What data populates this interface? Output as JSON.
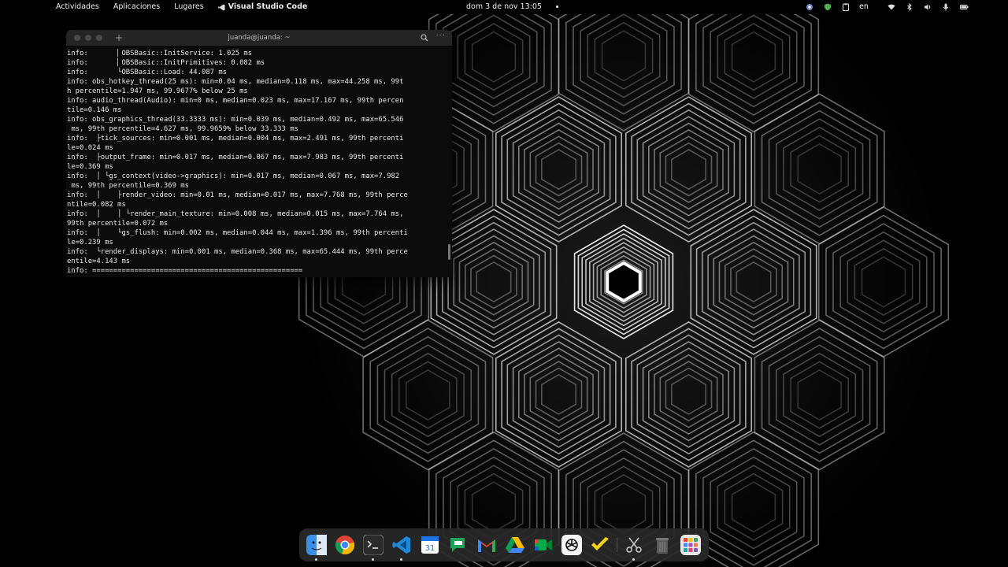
{
  "topbar": {
    "activities": "Actividades",
    "applications": "Aplicaciones",
    "places": "Lugares",
    "active_app": "Visual Studio Code",
    "datetime": "dom 3 de nov  13:05",
    "language": "en",
    "tray_icons": [
      "screenshot-icon",
      "shield-icon",
      "clipboard-icon",
      "wifi-icon",
      "bluetooth-icon",
      "volume-icon",
      "microphone-icon",
      "battery-icon"
    ]
  },
  "terminal": {
    "title": "juanda@juanda: ~",
    "lines": [
      "info:       ▏OBSBasic::InitService: 1.025 ms",
      "info:       ▏OBSBasic::InitPrimitives: 0.082 ms",
      "info:       └OBSBasic::Load: 44.087 ms",
      "info: obs_hotkey_thread(25 ms): min=0.04 ms, median=0.118 ms, max=44.258 ms, 99t",
      "h percentile=1.947 ms, 99.9677% below 25 ms",
      "info: audio_thread(Audio): min=0 ms, median=0.023 ms, max=17.167 ms, 99th percen",
      "tile=0.146 ms",
      "info: obs_graphics_thread(33.3333 ms): min=0.039 ms, median=0.492 ms, max=65.546",
      " ms, 99th percentile=4.627 ms, 99.9659% below 33.333 ms",
      "info:  ├tick_sources: min=0.001 ms, median=0.004 ms, max=2.491 ms, 99th percenti",
      "le=0.024 ms",
      "info:  ├output_frame: min=0.017 ms, median=0.067 ms, max=7.983 ms, 99th percenti",
      "le=0.369 ms",
      "info:  │ └gs_context(video->graphics): min=0.017 ms, median=0.067 ms, max=7.982",
      " ms, 99th percentile=0.369 ms",
      "info:  │    ├render_video: min=0.01 ms, median=0.017 ms, max=7.768 ms, 99th perce",
      "ntile=0.082 ms",
      "info:  │    │ └render_main_texture: min=0.008 ms, median=0.015 ms, max=7.764 ms,",
      "99th percentile=0.072 ms",
      "info:  │    └gs_flush: min=0.002 ms, median=0.044 ms, max=1.396 ms, 99th percenti",
      "le=0.239 ms",
      "info:  └render_displays: min=0.001 ms, median=0.368 ms, max=65.444 ms, 99th perce",
      "entile=4.143 ms",
      "info: =================================================="
    ]
  },
  "dock": {
    "apps": [
      {
        "name": "finder",
        "color": "#3a8fe8"
      },
      {
        "name": "chrome",
        "color": "#e8e8e8"
      },
      {
        "name": "terminal",
        "color": "#2b2b2b"
      },
      {
        "name": "vscode",
        "color": "#1f6fb8"
      },
      {
        "name": "calendar",
        "color": "#2a6ad8"
      },
      {
        "name": "chat",
        "color": "#1ea25a"
      },
      {
        "name": "gmail",
        "color": "#f2f2f2"
      },
      {
        "name": "drive",
        "color": "#2a2a2a"
      },
      {
        "name": "meet",
        "color": "#1e8e3e"
      },
      {
        "name": "chatgpt",
        "color": "#f4f4f4"
      },
      {
        "name": "sticky",
        "color": "#f2d21b"
      },
      {
        "name": "screenshot",
        "color": "#3a3a3a"
      },
      {
        "name": "trash",
        "color": "#3a3a3a"
      },
      {
        "name": "app-grid",
        "color": "#f0a5b8"
      }
    ]
  }
}
